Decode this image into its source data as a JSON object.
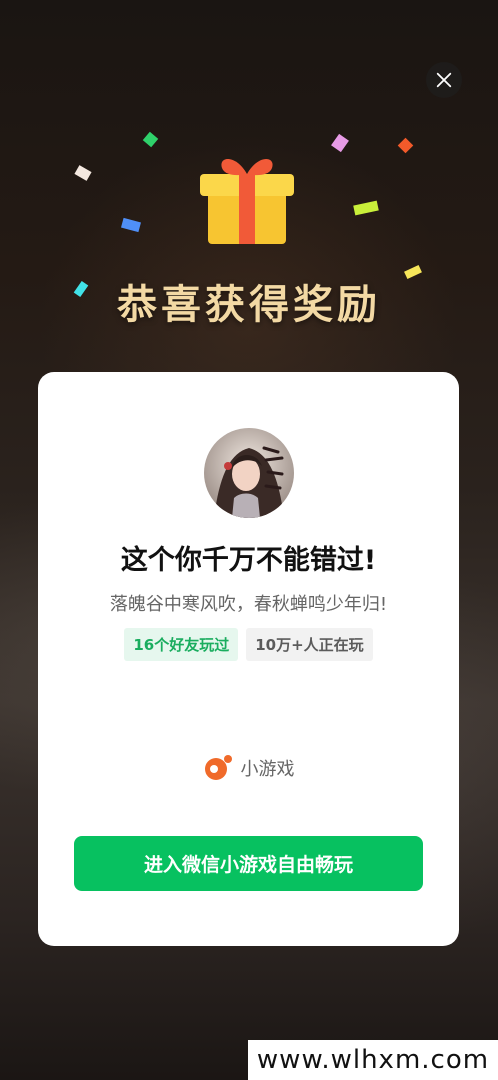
{
  "popup": {
    "congrats_title": "恭喜获得奖励",
    "close_icon": "close-icon",
    "gift_icon": "gift-icon"
  },
  "card": {
    "game_title": "这个你千万不能错过!",
    "game_description": "落魄谷中寒风吹，春秋蝉鸣少年归!",
    "tags": {
      "friends": "16个好友玩过",
      "players": "10万+人正在玩"
    },
    "brand_label": "小游戏",
    "brand_icon": "mini-game-logo-icon",
    "cta_label": "进入微信小游戏自由畅玩"
  },
  "watermark": "www.wlhxm.com",
  "colors": {
    "accent_green": "#07c160",
    "congrats_gold": "#f3d9a4",
    "tag_green": "#1aad5f",
    "brand_orange": "#f06a2a"
  }
}
